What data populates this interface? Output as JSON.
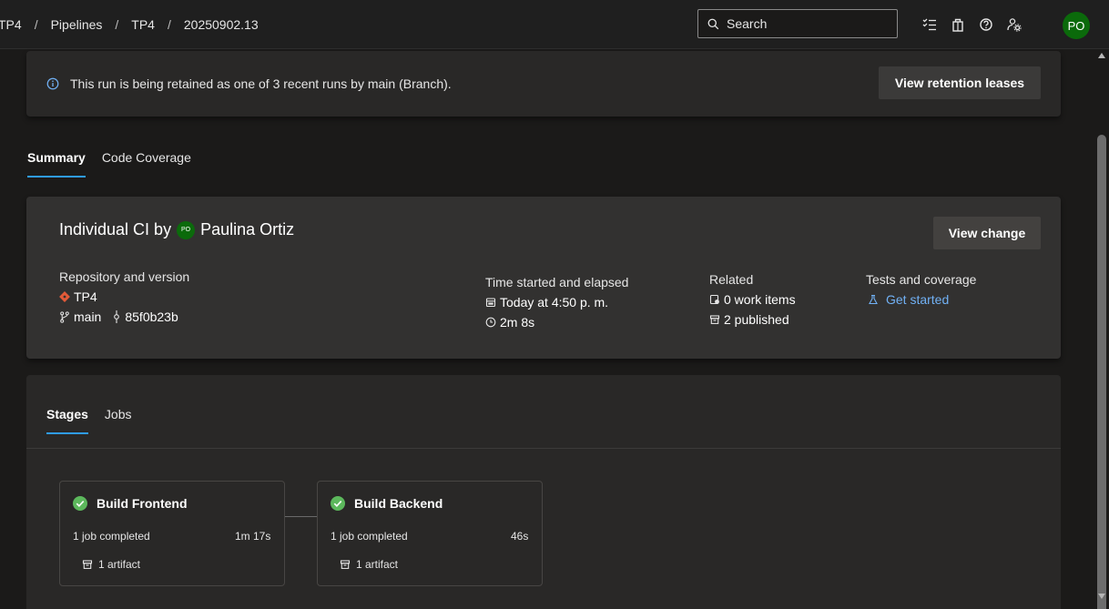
{
  "breadcrumbs": [
    "TP4",
    "Pipelines",
    "TP4",
    "20250902.13"
  ],
  "breadcrumb_separator": "/",
  "search": {
    "label": "Search"
  },
  "user": {
    "initials": "PO"
  },
  "banner": {
    "text": "This run is being retained as one of 3 recent runs by main (Branch).",
    "button_label": "View retention leases"
  },
  "tabs": [
    {
      "label": "Summary",
      "active": true
    },
    {
      "label": "Code Coverage",
      "active": false
    }
  ],
  "summary": {
    "title_prefix": "Individual CI by",
    "author_initials": "PO",
    "author": "Paulina Ortiz",
    "view_change_label": "View change",
    "repo_label": "Repository and version",
    "repo_name": "TP4",
    "branch": "main",
    "commit": "85f0b23b",
    "time_label": "Time started and elapsed",
    "started": "Today at 4:50 p. m.",
    "elapsed": "2m 8s",
    "related_label": "Related",
    "work_items": "0 work items",
    "published": "2 published",
    "tests_label": "Tests and coverage",
    "tests_link": "Get started"
  },
  "stage_tabs": [
    {
      "label": "Stages",
      "active": true
    },
    {
      "label": "Jobs",
      "active": false
    }
  ],
  "stages": [
    {
      "name": "Build Frontend",
      "status": "1 job completed",
      "duration": "1m 17s",
      "artifacts": "1 artifact"
    },
    {
      "name": "Build Backend",
      "status": "1 job completed",
      "duration": "46s",
      "artifacts": "1 artifact"
    }
  ],
  "colors": {
    "accent": "#2f9cf0",
    "success": "#5cb85c",
    "avatar": "#0b6a0b",
    "git_red": "#e25a38",
    "link": "#71b1f5"
  }
}
